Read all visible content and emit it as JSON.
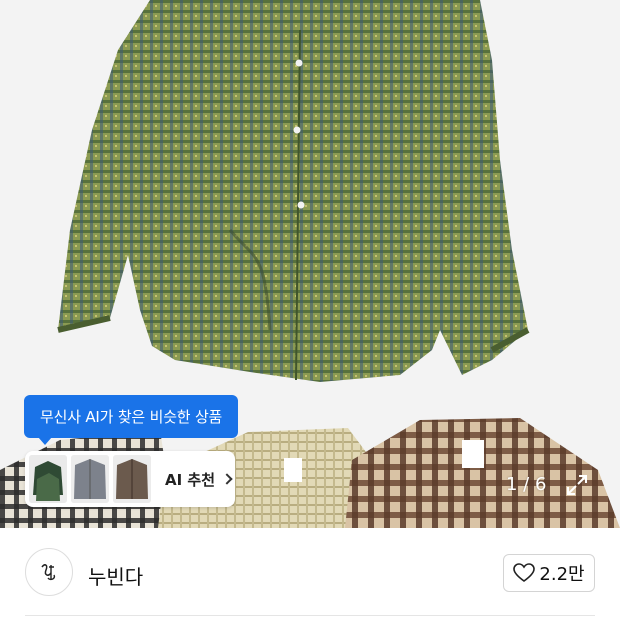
{
  "product_image": {
    "main_alt_icon": "green-plaid-shirt-image",
    "counter": "1 / 6"
  },
  "ai_recommend": {
    "tooltip": "무신사 AI가 찾은 비슷한 상품",
    "card_label": "AI 추천",
    "thumb_count": 3
  },
  "brand": {
    "name": "누빈다",
    "logo_icon": "brand-logo-icon"
  },
  "like": {
    "count": "2.2만",
    "icon": "heart-icon"
  },
  "colors": {
    "accent": "#1a73e8",
    "shirt_green": "#6b7f3a",
    "shirt_beige": "#d8cfa8",
    "shirt_brown": "#5a3b2a"
  }
}
